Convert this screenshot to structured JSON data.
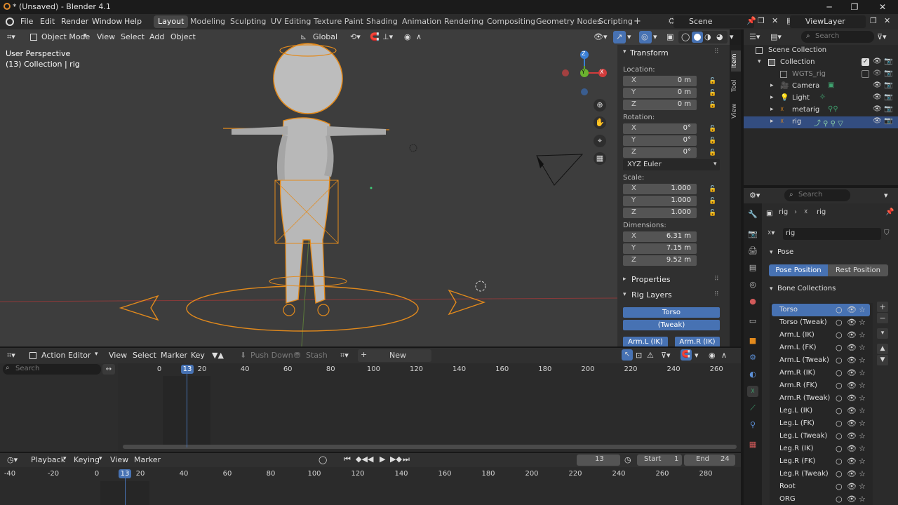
{
  "window": {
    "title": "* (Unsaved) - Blender 4.1",
    "minimize": "─",
    "maximize": "❐",
    "close": "✕"
  },
  "menubar": {
    "items": [
      "File",
      "Edit",
      "Render",
      "Window",
      "Help"
    ],
    "workspaces": [
      "Layout",
      "Modeling",
      "Sculpting",
      "UV Editing",
      "Texture Paint",
      "Shading",
      "Animation",
      "Rendering",
      "Compositing",
      "Geometry Nodes",
      "Scripting"
    ],
    "active_workspace": "Layout",
    "add_workspace": "+",
    "scene": "Scene",
    "view_layer": "ViewLayer"
  },
  "viewport_header": {
    "mode": "Object Mode",
    "menus": [
      "View",
      "Select",
      "Add",
      "Object"
    ],
    "orientation": "Global"
  },
  "viewport": {
    "view_name": "User Perspective",
    "collection_info": "(13) Collection | rig",
    "gizmo": {
      "z": "Z",
      "y": "Y",
      "x": "X"
    }
  },
  "npanel": {
    "tabs": [
      "Item",
      "Tool",
      "View"
    ],
    "transform_title": "Transform",
    "location_label": "Location:",
    "location": [
      {
        "axis": "X",
        "value": "0 m"
      },
      {
        "axis": "Y",
        "value": "0 m"
      },
      {
        "axis": "Z",
        "value": "0 m"
      }
    ],
    "rotation_label": "Rotation:",
    "rotation": [
      {
        "axis": "X",
        "value": "0°"
      },
      {
        "axis": "Y",
        "value": "0°"
      },
      {
        "axis": "Z",
        "value": "0°"
      }
    ],
    "rotation_mode": "XYZ Euler",
    "scale_label": "Scale:",
    "scale": [
      {
        "axis": "X",
        "value": "1.000"
      },
      {
        "axis": "Y",
        "value": "1.000"
      },
      {
        "axis": "Z",
        "value": "1.000"
      }
    ],
    "dimensions_label": "Dimensions:",
    "dimensions": [
      {
        "axis": "X",
        "value": "6.31 m"
      },
      {
        "axis": "Y",
        "value": "7.15 m"
      },
      {
        "axis": "Z",
        "value": "9.52 m"
      }
    ],
    "properties_title": "Properties",
    "rig_layers_title": "Rig Layers",
    "rig_layers": [
      "Torso",
      "(Tweak)",
      "Arm.L (IK)",
      "Arm.R (IK)"
    ]
  },
  "outliner": {
    "search_placeholder": "Search",
    "items": [
      {
        "name": "Scene Collection"
      },
      {
        "name": "Collection"
      },
      {
        "name": "WGTS_rig"
      },
      {
        "name": "Camera"
      },
      {
        "name": "Light"
      },
      {
        "name": "metarig"
      },
      {
        "name": "rig"
      }
    ]
  },
  "properties": {
    "search_placeholder": "Search",
    "breadcrumb": [
      "rig",
      "rig"
    ],
    "data_name": "rig",
    "pose_title": "Pose",
    "pose_position": "Pose Position",
    "rest_position": "Rest Position",
    "bone_collections_title": "Bone Collections",
    "bone_collections": [
      "Torso",
      "Torso (Tweak)",
      "Arm.L (IK)",
      "Arm.L (FK)",
      "Arm.L (Tweak)",
      "Arm.R (IK)",
      "Arm.R (FK)",
      "Arm.R (Tweak)",
      "Leg.L (IK)",
      "Leg.L (FK)",
      "Leg.L (Tweak)",
      "Leg.R (IK)",
      "Leg.R (FK)",
      "Leg.R (Tweak)",
      "Root",
      "ORG"
    ],
    "selected_bone_collection": "Torso"
  },
  "action_editor": {
    "mode": "Action Editor",
    "menus": [
      "View",
      "Select",
      "Marker",
      "Key"
    ],
    "push_down": "Push Down",
    "stash": "Stash",
    "new": "New",
    "search_placeholder": "Search",
    "ticks": [
      "0",
      "20",
      "40",
      "60",
      "80",
      "100",
      "120",
      "140",
      "160",
      "180",
      "200",
      "220",
      "240",
      "260"
    ],
    "current_frame": "13"
  },
  "timeline": {
    "menus": [
      "Playback",
      "Keying",
      "View",
      "Marker"
    ],
    "current_frame": "13",
    "start_label": "Start",
    "start": "1",
    "end_label": "End",
    "end": "24",
    "ticks": [
      "-40",
      "-20",
      "0",
      "20",
      "40",
      "60",
      "80",
      "100",
      "120",
      "140",
      "160",
      "180",
      "200",
      "220",
      "240",
      "260",
      "280"
    ]
  }
}
